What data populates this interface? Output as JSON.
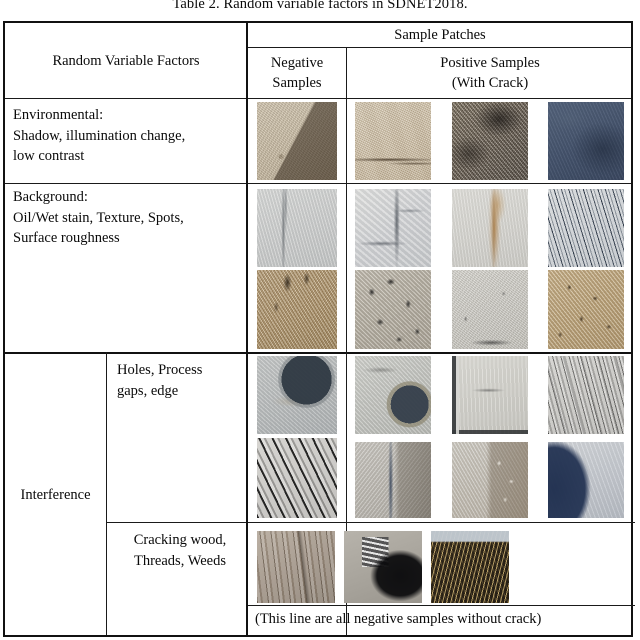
{
  "caption": "Table 2.  Random variable factors in SDNET2018.",
  "table": {
    "header": {
      "factors": "Random Variable Factors",
      "sample_patches": "Sample Patches",
      "negative_line1": "Negative",
      "negative_line2": "Samples",
      "positive_line1": "Positive Samples",
      "positive_line2": "(With Crack)"
    },
    "rows": [
      {
        "label": "Environmental:\nShadow, illumination change,\n low contrast",
        "negative_patches": [
          "tan concrete with hard diagonal shadow"
        ],
        "positive_patches": [
          "light tan asphalt with thin crack",
          "dark mottled grey-brown surface",
          "deep blue-grey low contrast surface"
        ]
      },
      {
        "label": "Background:\nOil/Wet stain, Texture, Spots,\n Surface roughness",
        "negative_patches": [
          "pale grey stone with fine vertical crack",
          "coarse tan rough render"
        ],
        "positive_patches": [
          "marble-like grey with branching dark vein",
          "pale grey with rust/tan stain streak",
          "brushed grey-blue striated surface",
          "grey concrete with dark aggregate spots",
          "light grey rough concrete",
          "tan pebbled surface with dark flecks"
        ]
      },
      {
        "label": "Interference",
        "sub_rows": [
          {
            "label": "Holes, Process\ngaps, edge",
            "negative_patches": [
              "grey concrete with large round hole",
              "strong diagonal dark striations"
            ],
            "positive_patches": [
              "grey concrete with round hole at right",
              "grey panel with process gap at edge",
              "heavy diagonal striated rough concrete",
              "grey surface with crack and rough right half",
              "smooth left half with gravel right half",
              "deep navy shadow wedge on light concrete"
            ]
          },
          {
            "label": "Cracking wood,\n Threads, Weeds",
            "patches": [
              "weathered cracking wood planks",
              "threaded bolt on dark ground",
              "dry weeds and straw over dark soil"
            ],
            "note": "(This line are all negative samples without crack)"
          }
        ]
      }
    ]
  },
  "colors": {
    "border": "#111111",
    "rule": "#1a1a1a",
    "page_background": "#ffffff",
    "text": "#0a0a0a"
  }
}
